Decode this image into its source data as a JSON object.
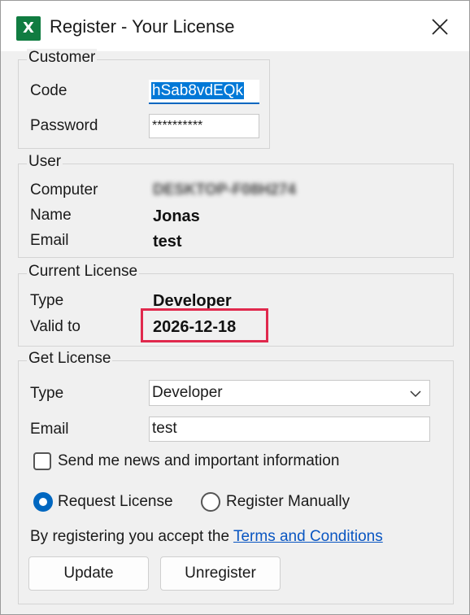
{
  "window": {
    "title": "Register - Your License",
    "app_icon": "excel-icon",
    "app_icon_letter": "X"
  },
  "customer": {
    "legend": "Customer",
    "code_label": "Code",
    "code_value": "hSab8vdEQk",
    "password_label": "Password",
    "password_value": "**********"
  },
  "user": {
    "legend": "User",
    "computer_label": "Computer",
    "computer_value": "DESKTOP-F08H274",
    "name_label": "Name",
    "name_value": "Jonas",
    "email_label": "Email",
    "email_value": "test"
  },
  "current_license": {
    "legend": "Current License",
    "type_label": "Type",
    "type_value": "Developer",
    "valid_label": "Valid to",
    "valid_value": "2026-12-18"
  },
  "get_license": {
    "legend": "Get License",
    "type_label": "Type",
    "type_selected": "Developer",
    "email_label": "Email",
    "email_value": "test",
    "news_checkbox_label": "Send me news and important information",
    "news_checked": false,
    "radio_request_label": "Request License",
    "radio_manual_label": "Register Manually",
    "selected_option": "Request License",
    "terms_prefix": "By registering you accept the",
    "terms_link": "Terms and Conditions"
  },
  "buttons": {
    "update": "Update",
    "unregister": "Unregister"
  },
  "colors": {
    "accent": "#0067c0",
    "highlight_border": "#e0294d",
    "excel_green": "#107c41",
    "link": "#0a56c2"
  }
}
